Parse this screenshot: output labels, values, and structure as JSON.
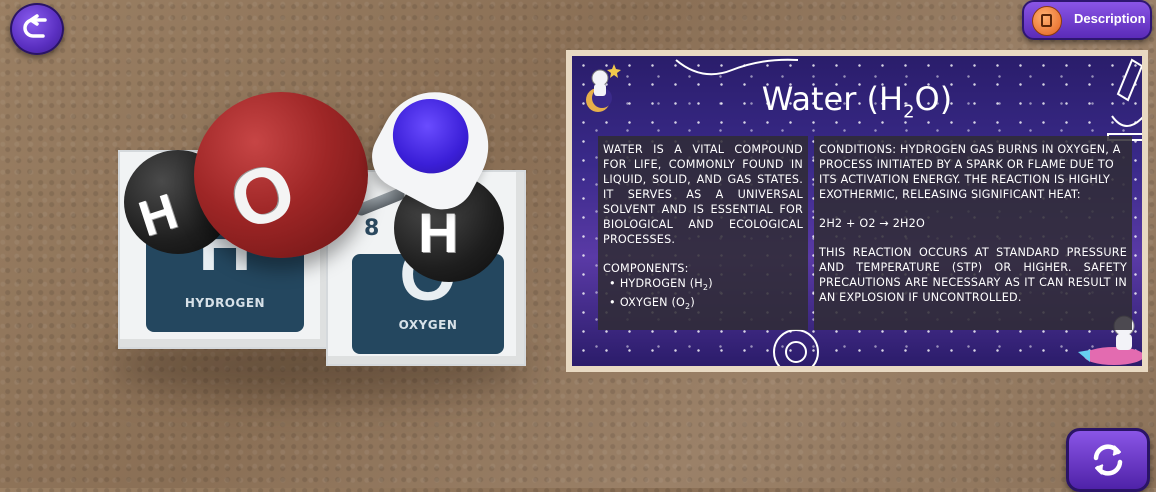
{
  "header": {
    "description_label": "Description"
  },
  "molecule": {
    "atoms": [
      {
        "symbol": "H",
        "color": "#1e1e1e"
      },
      {
        "symbol": "O",
        "color": "#9e2626"
      },
      {
        "symbol": "H",
        "color": "#1e1e1e"
      }
    ]
  },
  "cubes": [
    {
      "symbol": "H",
      "name": "HYDROGEN",
      "number": ""
    },
    {
      "symbol": "O",
      "name": "OXYGEN",
      "number": "8"
    }
  ],
  "panel": {
    "title_prefix": "Water (H",
    "title_sub": "2",
    "title_suffix": "O)",
    "intro": "WATER IS A VITAL COMPOUND FOR LIFE, COMMONLY FOUND IN LIQUID, SOLID, AND GAS STATES. IT SERVES AS A UNIVERSAL SOLVENT AND IS ESSENTIAL FOR BIOLOGICAL AND ECOLOGICAL PROCESSES.",
    "components_label": "COMPONENTS:",
    "components": [
      {
        "prefix": "HYDROGEN (H",
        "sub": "2",
        "suffix": ")"
      },
      {
        "prefix": "OXYGEN (O",
        "sub": "2",
        "suffix": ")"
      }
    ],
    "conditions": "CONDITIONS: HYDROGEN GAS BURNS IN OXYGEN, A PROCESS INITIATED BY A SPARK OR FLAME DUE TO ITS ACTIVATION ENERGY. THE REACTION IS HIGHLY EXOTHERMIC, RELEASING SIGNIFICANT HEAT:",
    "equation": "2H2 + O2 → 2H2O",
    "safety": "THIS REACTION OCCURS AT STANDARD PRESSURE AND TEMPERATURE (STP) OR HIGHER. SAFETY PRECAUTIONS ARE NECESSARY AS IT CAN RESULT IN AN EXPLOSION IF UNCONTROLLED."
  },
  "colors": {
    "button_purple": "#6a3ad0",
    "panel_border": "#e8d9c2",
    "panel_bg": "#3a2a8a",
    "text_box": "#302c34"
  },
  "icons": {
    "back": "back-arrow-icon",
    "description": "document-icon",
    "refresh": "refresh-icon"
  }
}
